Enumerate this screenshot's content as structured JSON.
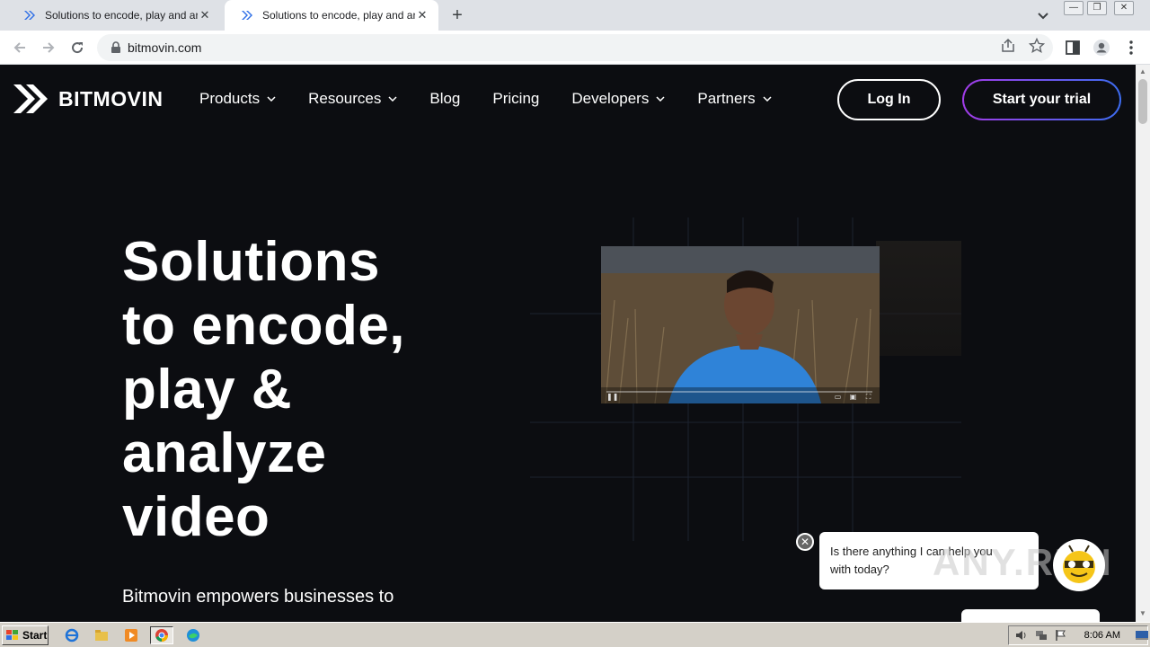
{
  "browser": {
    "tabs": [
      {
        "title": "Solutions to encode, play and analyze",
        "active": false
      },
      {
        "title": "Solutions to encode, play and analyze",
        "active": true
      }
    ],
    "new_tab_symbol": "+",
    "close_symbol": "✕",
    "url": "bitmovin.com"
  },
  "site": {
    "logo_text": "BITMOVIN",
    "nav": [
      {
        "label": "Products",
        "has_dropdown": true
      },
      {
        "label": "Resources",
        "has_dropdown": true
      },
      {
        "label": "Blog",
        "has_dropdown": false
      },
      {
        "label": "Pricing",
        "has_dropdown": false
      },
      {
        "label": "Developers",
        "has_dropdown": true
      },
      {
        "label": "Partners",
        "has_dropdown": true
      }
    ],
    "login_label": "Log In",
    "trial_label": "Start your trial",
    "hero": {
      "title_lines": [
        "Solutions",
        "to encode,",
        "play &",
        "analyze",
        "video"
      ],
      "subtitle": "Bitmovin empowers businesses to"
    },
    "chat": {
      "message_line1": "Is there anything I can help you",
      "message_line2": "with today?",
      "close_symbol": "✕"
    },
    "watermark": "ANY.RUN"
  },
  "taskbar": {
    "start_label": "Start",
    "clock": "8:06 AM",
    "apps": [
      "ie-icon",
      "explorer-icon",
      "media-player-icon",
      "chrome-icon",
      "edge-icon"
    ]
  },
  "colors": {
    "page_bg": "#0c0d11",
    "trial_gradient_start": "#a23ce8",
    "trial_gradient_end": "#3d6cf0"
  }
}
